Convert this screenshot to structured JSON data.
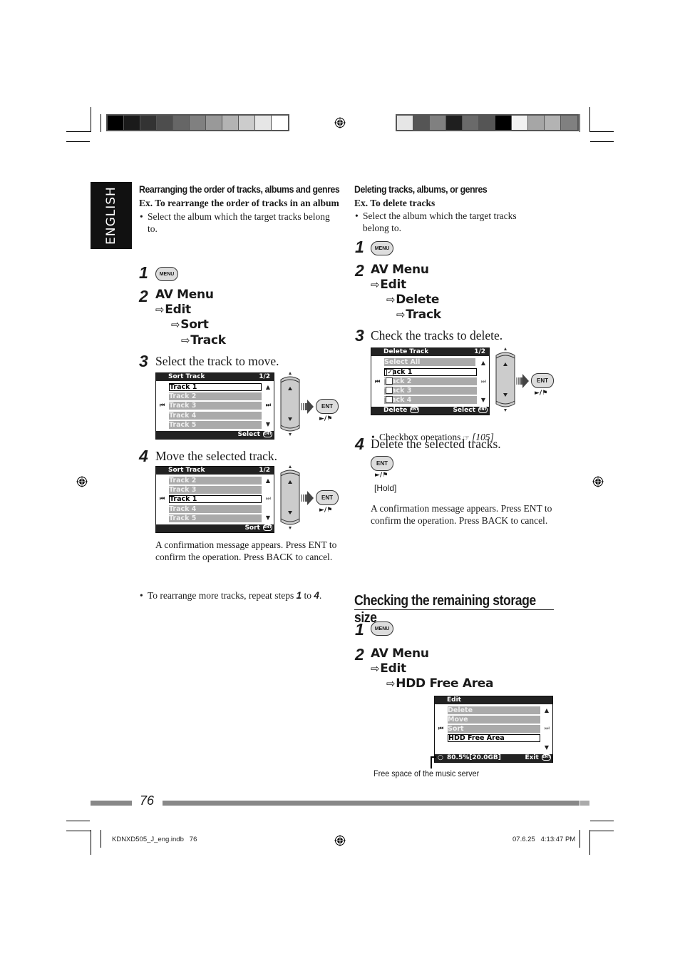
{
  "print_marks": {
    "colorbar_left": [
      "#000000",
      "#1a1a1a",
      "#333333",
      "#4d4d4d",
      "#666666",
      "#808080",
      "#999999",
      "#b3b3b3",
      "#cccccc",
      "#e6e6e6",
      "#ffffff"
    ],
    "colorbar_right": [
      "#e6e6e6",
      "#555555",
      "#808080",
      "#1f1f1f",
      "#6a6a6a",
      "#555555",
      "#000000",
      "#f2f2f2",
      "#a6a6a6",
      "#b3b3b3",
      "#808080"
    ]
  },
  "language_tab": "ENGLISH",
  "rearrange": {
    "title": "Rearranging the order of tracks, albums and genres",
    "example": "Ex. To rearrange the order of tracks in an album",
    "bullet": "Select the album which the target tracks belong to.",
    "step1": {
      "num": "1",
      "button": "MENU"
    },
    "step2": {
      "num": "2",
      "path": [
        "AV Menu",
        "Edit",
        "Sort",
        "Track"
      ]
    },
    "step3": {
      "num": "3",
      "text": "Select the track to move.",
      "screen": {
        "title": "Sort Track",
        "page": "1/2",
        "rows": [
          "Track 1",
          "Track 2",
          "Track 3",
          "Track 4",
          "Track 5"
        ],
        "selected_index": 0,
        "footer": "Select"
      }
    },
    "step4": {
      "num": "4",
      "text": "Move the selected track.",
      "screen": {
        "title": "Sort Track",
        "page": "1/2",
        "rows": [
          "Track 2",
          "Track 3",
          "Track 1",
          "Track 4",
          "Track 5"
        ],
        "selected_index": 2,
        "footer": "Sort"
      }
    },
    "confirm": "A confirmation message appears. Press ENT to confirm the operation. Press BACK to cancel.",
    "repeat_note": {
      "pre": "To rearrange more tracks, repeat steps ",
      "a": "1",
      "mid": " to ",
      "b": "4",
      "post": "."
    }
  },
  "delete": {
    "title": "Deleting tracks, albums, or genres",
    "example": "Ex. To delete tracks",
    "bullet": "Select the album which the target tracks belong to.",
    "step1": {
      "num": "1",
      "button": "MENU"
    },
    "step2": {
      "num": "2",
      "path": [
        "AV Menu",
        "Edit",
        "Delete",
        "Track"
      ]
    },
    "step3": {
      "num": "3",
      "text": "Check the tracks to delete.",
      "screen": {
        "title": "Delete Track",
        "page": "1/2",
        "select_all": "Select All",
        "rows": [
          {
            "label": "Track 1",
            "checked": true
          },
          {
            "label": "Track 2",
            "checked": false
          },
          {
            "label": "Track 3",
            "checked": false
          },
          {
            "label": "Track 4",
            "checked": false
          }
        ],
        "selected_index": 0,
        "footer_left": "Delete",
        "footer_right": "Select"
      },
      "note": "Checkbox operations",
      "note_ref": "[105]"
    },
    "step4": {
      "num": "4",
      "text": "Delete the selected tracks.",
      "hold": "[Hold]"
    },
    "confirm": "A confirmation message appears. Press ENT to confirm the operation. Press BACK to cancel."
  },
  "storage": {
    "title": "Checking the remaining storage size",
    "step1": {
      "num": "1",
      "button": "MENU"
    },
    "step2": {
      "num": "2",
      "path": [
        "AV Menu",
        "Edit",
        "HDD Free Area"
      ]
    },
    "screen": {
      "title": "Edit",
      "rows": [
        "Delete",
        "Move",
        "Sort",
        "HDD Free Area"
      ],
      "selected_index": 3,
      "free_space": "80.5%[20.0GB]",
      "footer": "Exit"
    },
    "caption": "Free space of the music server"
  },
  "controls": {
    "ent_label": "ENT",
    "play_pause": "►/⏵",
    "menu_label": "MENU"
  },
  "page_number": "76",
  "slug": {
    "file": "KDNXD505_J_eng.indb   76",
    "timestamp": "07.6.25   4:13:47 PM"
  }
}
